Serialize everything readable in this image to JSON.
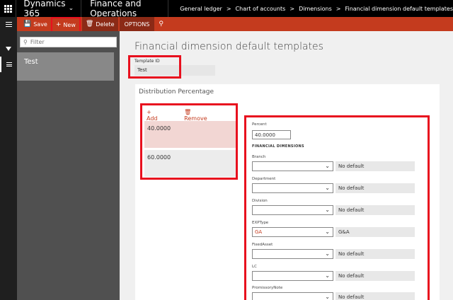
{
  "topbar": {
    "app_name": "Dynamics 365",
    "module": "Finance and Operations",
    "breadcrumb": [
      "General ledger",
      "Chart of accounts",
      "Dimensions",
      "Financial dimension default templates"
    ]
  },
  "actionbar": {
    "save_label": "Save",
    "new_label": "New",
    "delete_label": "Delete",
    "options_label": "OPTIONS"
  },
  "listpane": {
    "filter_placeholder": "Filter",
    "items": [
      "Test"
    ]
  },
  "main": {
    "title": "Financial dimension default templates",
    "template_id_label": "Template ID",
    "template_id_value": "Test",
    "distribution_title": "Distribution Percentage",
    "add_label": "Add",
    "remove_label": "Remove",
    "rows": [
      "40.0000",
      "60.0000"
    ],
    "percent_label": "Percent",
    "percent_value": "40.0000",
    "fin_dims_heading": "FINANCIAL DIMENSIONS",
    "dimensions": [
      {
        "label": "Branch",
        "value": "",
        "desc": "No default"
      },
      {
        "label": "Department",
        "value": "",
        "desc": "No default"
      },
      {
        "label": "Division",
        "value": "",
        "desc": "No default"
      },
      {
        "label": "EXPType",
        "value": "GA",
        "desc": "G&A"
      },
      {
        "label": "FixedAsset",
        "value": "",
        "desc": "No default"
      },
      {
        "label": "LC",
        "value": "",
        "desc": "No default"
      },
      {
        "label": "PromissoryNote",
        "value": "",
        "desc": "No default"
      }
    ]
  },
  "colors": {
    "accent": "#c43b1e",
    "highlight": "#e8101e",
    "selected_row": "#f2d6d3"
  }
}
